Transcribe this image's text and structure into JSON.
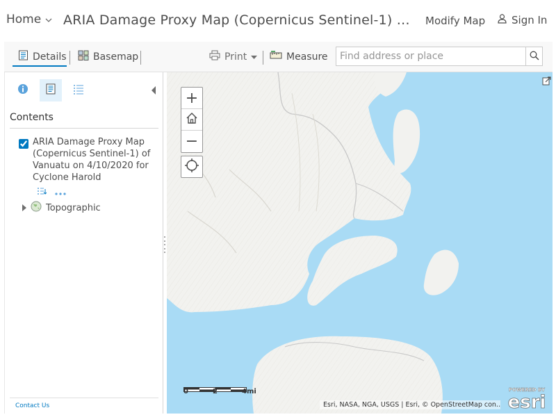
{
  "header": {
    "home_label": "Home",
    "title": "ARIA Damage Proxy Map (Copernicus Sentinel-1) …",
    "modify_label": "Modify Map",
    "signin_label": "Sign In"
  },
  "toolbar": {
    "details_label": "Details",
    "basemap_label": "Basemap",
    "print_label": "Print",
    "measure_label": "Measure",
    "search_placeholder": "Find address or place"
  },
  "panel": {
    "contents_label": "Contents",
    "layers": [
      {
        "title": "ARIA Damage Proxy Map (Copernicus Sentinel-1) of Vanuatu on 4/10/2020 for Cyclone Harold",
        "checked": true
      },
      {
        "title": "Topographic"
      }
    ],
    "contact_label": "Contact Us"
  },
  "map": {
    "zoom_in": "+",
    "zoom_out": "−",
    "scale_labels": [
      "0",
      "2",
      "4mi"
    ],
    "attribution": "Esri, NASA, NGA, USGS | Esri, © OpenStreetMap con…",
    "logo_top": "POWERED BY",
    "logo_main": "esri"
  },
  "colors": {
    "accent": "#0079c1",
    "water": "#a9dbf5",
    "land": "#f2f2ef"
  }
}
